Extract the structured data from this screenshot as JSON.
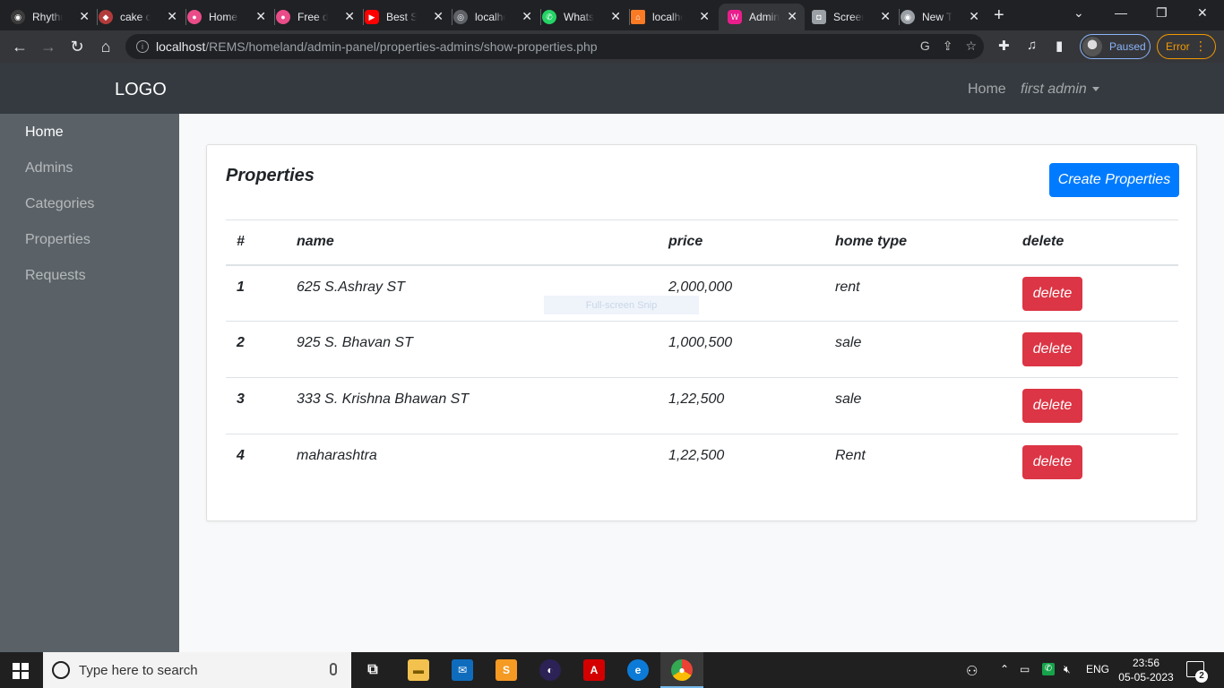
{
  "browser": {
    "tabs": [
      {
        "title": "Rhythm",
        "favicon": "github-icon",
        "color": "#3c3c3c"
      },
      {
        "title": "cake order",
        "favicon": "cake-icon",
        "color": "#b23b3b"
      },
      {
        "title": "Home",
        "favicon": "dribbble-icon",
        "color": "#ea4c89"
      },
      {
        "title": "Free design",
        "favicon": "dribbble-icon",
        "color": "#ea4c89"
      },
      {
        "title": "Best Songs",
        "favicon": "youtube-icon",
        "color": "#ff0000"
      },
      {
        "title": "localhost",
        "favicon": "globe-icon",
        "color": "#5f6368"
      },
      {
        "title": "WhatsApp",
        "favicon": "whatsapp-icon",
        "color": "#25d366"
      },
      {
        "title": "localhost",
        "favicon": "xampp-icon",
        "color": "#fb7a24"
      },
      {
        "title": "Admin",
        "favicon": "admin-icon",
        "color": "#e91e8c",
        "active": true
      },
      {
        "title": "Screenshot",
        "favicon": "camera-icon",
        "color": "#9aa0a6"
      },
      {
        "title": "New Tab",
        "favicon": "chrome-icon",
        "color": "#9aa0a6"
      }
    ],
    "url_host": "localhost",
    "url_path": "/REMS/homeland/admin-panel/properties-admins/show-properties.php",
    "profile_status": "Paused",
    "error_label": "Error"
  },
  "navbar": {
    "logo": "LOGO",
    "home_link": "Home",
    "user_menu": "first admin"
  },
  "sidebar": {
    "items": [
      {
        "label": "Home",
        "active": true
      },
      {
        "label": "Admins"
      },
      {
        "label": "Categories"
      },
      {
        "label": "Properties"
      },
      {
        "label": "Requests"
      }
    ]
  },
  "main": {
    "title": "Properties",
    "create_button": "Create Properties",
    "columns": [
      "#",
      "name",
      "price",
      "home type",
      "delete"
    ],
    "rows": [
      {
        "id": "1",
        "name": "625 S.Ashray ST",
        "price": "2,000,000",
        "home_type": "rent",
        "action": "delete"
      },
      {
        "id": "2",
        "name": "925 S. Bhavan ST",
        "price": "1,000,500",
        "home_type": "sale",
        "action": "delete"
      },
      {
        "id": "3",
        "name": "333 S. Krishna Bhawan ST",
        "price": "1,22,500",
        "home_type": "sale",
        "action": "delete"
      },
      {
        "id": "4",
        "name": "maharashtra",
        "price": "1,22,500",
        "home_type": "Rent",
        "action": "delete"
      }
    ]
  },
  "overlay": {
    "snip_label": "Full-screen Snip"
  },
  "taskbar": {
    "search_placeholder": "Type here to search",
    "language": "ENG",
    "time": "23:56",
    "date": "05-05-2023",
    "notifications": "2"
  },
  "colors": {
    "primary": "#007bff",
    "danger": "#dc3545",
    "navbar": "#343a40",
    "sidebar": "#5a6268"
  }
}
